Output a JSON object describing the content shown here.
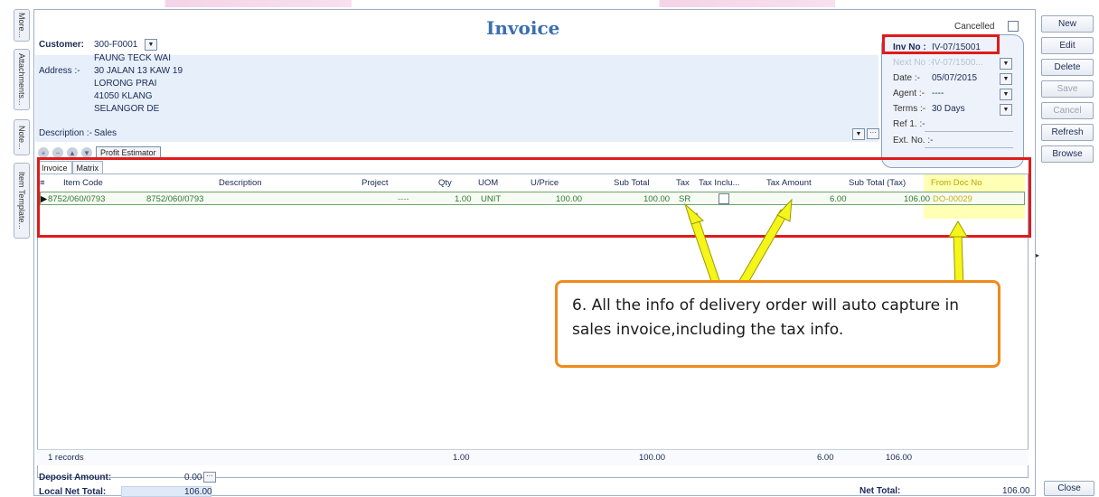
{
  "side_tabs": [
    "More...",
    "Attachments...",
    "Note...",
    "Item Template..."
  ],
  "title": "Invoice",
  "cancelled_label": "Cancelled",
  "customer": {
    "label": "Customer:",
    "code": "300-F0001",
    "name": "FAUNG TECK WAI",
    "address_label": "Address :-",
    "address": [
      "30 JALAN 13 KAW 19",
      "LORONG PRAI",
      "41050 KLANG",
      "SELANGOR DE"
    ]
  },
  "description": {
    "label": "Description :-",
    "value": "Sales"
  },
  "right_panel": {
    "inv_no_label": "Inv No :",
    "inv_no": "IV-07/15001",
    "next_no_label": "Next No :-",
    "next_no": "IV-07/1500...",
    "date_label": "Date :-",
    "date": "05/07/2015",
    "agent_label": "Agent :-",
    "agent": "----",
    "terms_label": "Terms :-",
    "terms": "30 Days",
    "ref1_label": "Ref 1. :-",
    "ext_no_label": "Ext. No. :-"
  },
  "toolbar": {
    "profit_estimator": "Profit Estimator"
  },
  "tabs": [
    "Invoice",
    "Matrix"
  ],
  "grid": {
    "columns": [
      "Item Code",
      "Description",
      "Project",
      "Qty",
      "UOM",
      "U/Price",
      "Sub Total",
      "Tax",
      "Tax Inclu...",
      "Tax Amount",
      "Sub Total (Tax)",
      "From Doc No"
    ],
    "row": {
      "item_code": "8752/060/0793",
      "description": "8752/060/0793",
      "project": "----",
      "qty": "1.00",
      "uom": "UNIT",
      "uprice": "100.00",
      "sub_total": "100.00",
      "tax": "SR",
      "tax_inclusive": false,
      "tax_amount": "6.00",
      "sub_total_tax": "106.00",
      "from_doc_no": "DO-00029"
    },
    "footer": {
      "records": "1 records",
      "qty": "1.00",
      "sub_total": "100.00",
      "tax_amount": "6.00",
      "sub_total_tax": "106.00"
    }
  },
  "callout": "6. All the info of delivery order will auto capture in sales invoice,including the tax info.",
  "bottom": {
    "deposit_label": "Deposit Amount:",
    "deposit_value": "0.00",
    "local_net_label": "Local Net Total:",
    "local_net_value": "106.00",
    "net_total_label": "Net Total:",
    "net_total_value": "106.00"
  },
  "buttons": {
    "new": "New",
    "edit": "Edit",
    "delete": "Delete",
    "save": "Save",
    "cancel": "Cancel",
    "refresh": "Refresh",
    "browse": "Browse",
    "close": "Close"
  },
  "colors": {
    "highlight_box": "#e01b1b",
    "callout_border": "#f08a1c",
    "arrow": "#f5f51a",
    "title": "#3b6fb1"
  }
}
